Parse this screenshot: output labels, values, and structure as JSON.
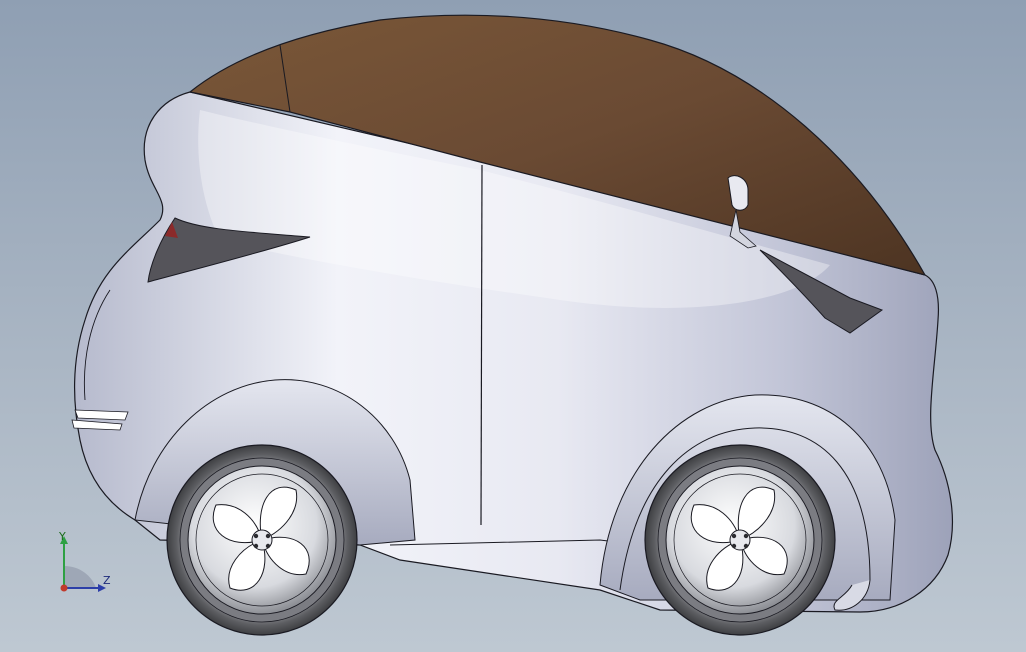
{
  "viewport": {
    "title": "",
    "background_top": "#8f9fb3",
    "background_bottom": "#bec8d2"
  },
  "model": {
    "body_color": "#d9dce8",
    "roof_color": "#6b4b33",
    "glass_color": "#5c5a5f",
    "tire_color": "#6d6e72",
    "rim_color": "#d4d6da"
  },
  "triad": {
    "y_label": "Y",
    "z_label": "Z",
    "x_color": "#c0392b",
    "y_color": "#2ea043",
    "z_color": "#2c3ea8"
  }
}
